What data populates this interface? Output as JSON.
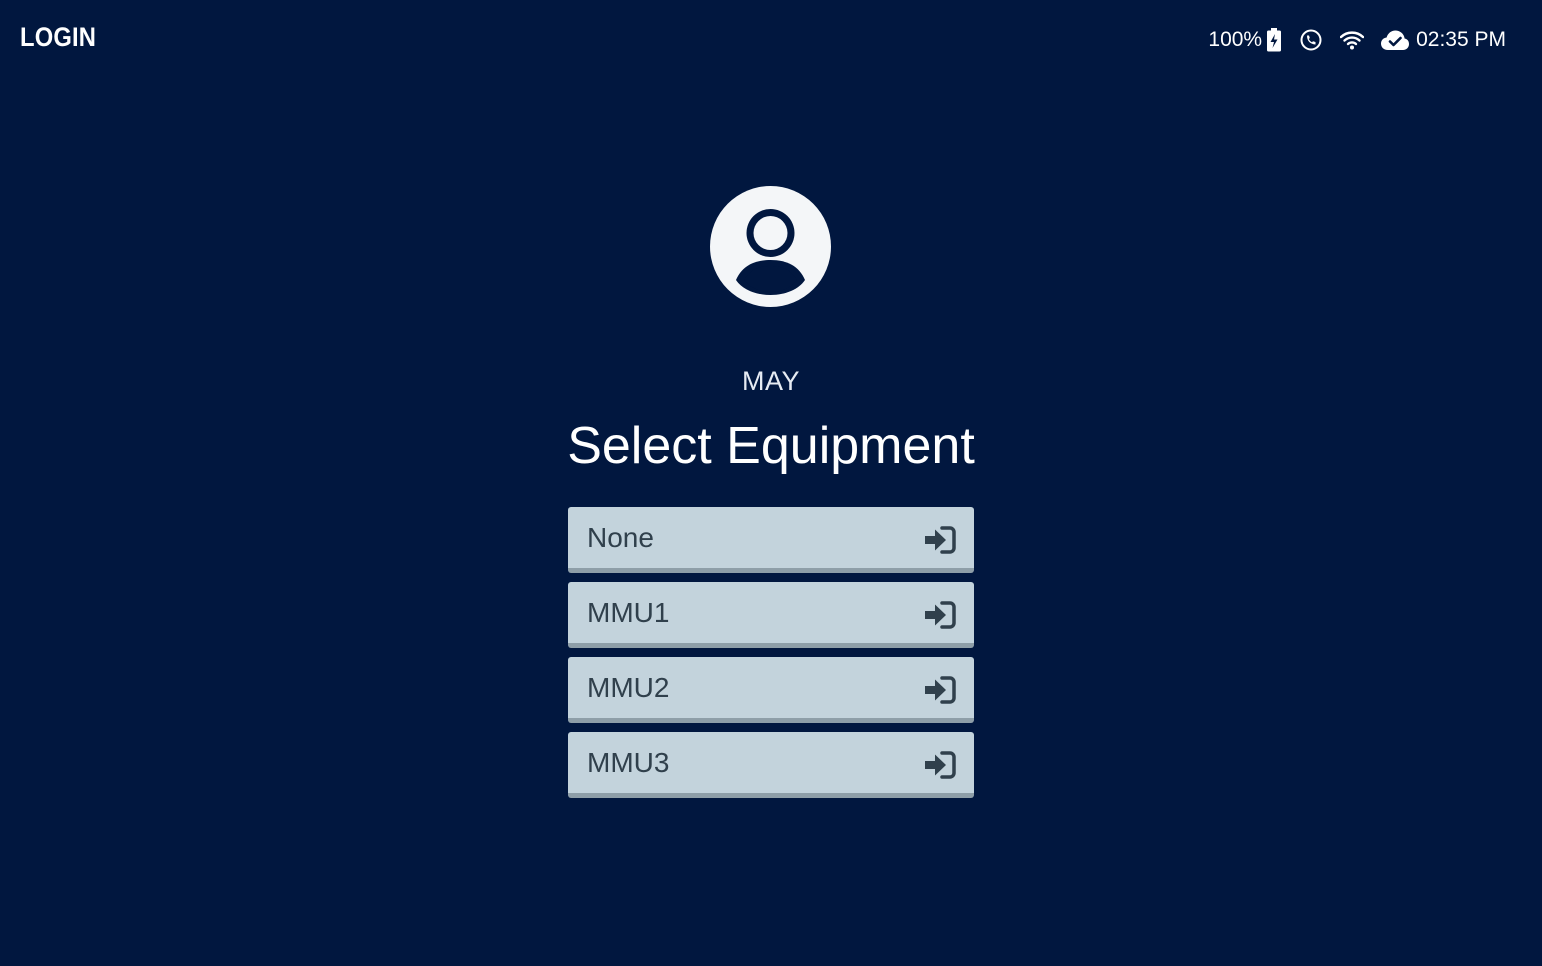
{
  "header": {
    "title": "LOGIN"
  },
  "status_bar": {
    "battery": "100%",
    "battery_icon": "battery-charging-icon",
    "phone_icon": "phone-icon",
    "wifi_icon": "wifi-icon",
    "cloud_icon": "cloud-check-icon",
    "time": "02:35 PM"
  },
  "user": {
    "avatar_icon": "user-avatar-icon",
    "name": "MAY"
  },
  "main": {
    "title": "Select Equipment",
    "equipment": [
      {
        "label": "None",
        "icon": "login-icon"
      },
      {
        "label": "MMU1",
        "icon": "login-icon"
      },
      {
        "label": "MMU2",
        "icon": "login-icon"
      },
      {
        "label": "MMU3",
        "icon": "login-icon"
      }
    ]
  },
  "colors": {
    "background": "#01173f",
    "button_bg": "#c3d3dc",
    "button_text": "#30404c",
    "button_shadow": "#8e9ea8"
  }
}
